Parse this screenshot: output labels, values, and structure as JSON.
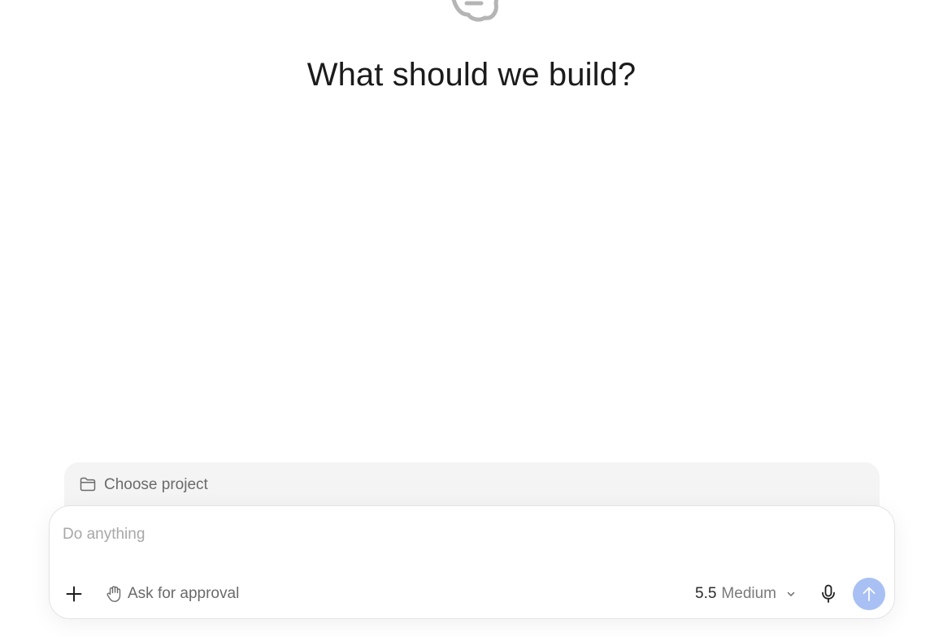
{
  "heading": "What should we build?",
  "project": {
    "icon": "folder-icon",
    "label": "Choose project"
  },
  "composer": {
    "placeholder": "Do anything",
    "value": "",
    "attach_icon": "plus-icon",
    "approval": {
      "icon": "hand-icon",
      "label": "Ask for approval"
    },
    "model": {
      "version": "5.5",
      "effort": "Medium",
      "icon": "chevron-down-icon"
    },
    "mic_icon": "microphone-icon",
    "send_icon": "arrow-up-icon"
  },
  "colors": {
    "send_button": "#a8c0f4",
    "project_bar": "#f4f4f4",
    "muted_text": "#6a6a6a",
    "placeholder_text": "#a8a8a8"
  }
}
